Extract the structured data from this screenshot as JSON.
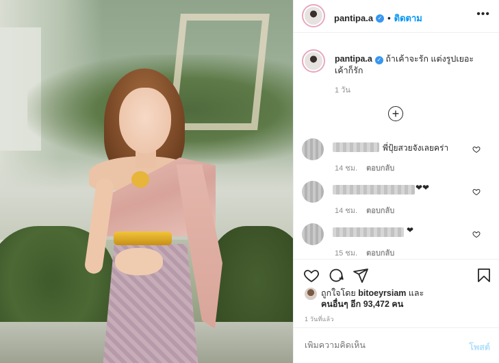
{
  "post": {
    "username": "pantipa.a",
    "follow_label": "ติดตาม",
    "more_icon": "more-horizontal-icon",
    "caption_text": "ถ้าเค้าจะรัก แต่งรูปเยอะเค้าก็รัก",
    "caption_time": "1 วัน",
    "load_more_icon": "plus-circle-icon"
  },
  "comments": [
    {
      "text": "พี่ปุ้ยสวยจังเลยคร่า",
      "time": "14 ชม.",
      "reply": "ตอบกลับ"
    },
    {
      "text": "❤❤",
      "time": "14 ชม.",
      "reply": "ตอบกลับ"
    },
    {
      "text": "❤",
      "time": "15 ชม.",
      "reply": "ตอบกลับ"
    }
  ],
  "actions": {
    "like_icon": "heart-icon",
    "comment_icon": "comment-icon",
    "share_icon": "paper-plane-icon",
    "save_icon": "bookmark-icon"
  },
  "likes": {
    "prefix": "ถูกใจโดย",
    "liker": "bitoeyrsiam",
    "and": "และ",
    "others_label": "คนอื่นๆ อีก 93,472 คน"
  },
  "post_time": "1 วันที่แล้ว",
  "add_comment": {
    "placeholder": "เพิ่มความคิดเห็น",
    "post_label": "โพสต์"
  },
  "colors": {
    "link_blue": "#0095f6",
    "verified_blue": "#3897f0",
    "post_disabled": "#b2dffc",
    "muted_text": "#8e8e8e"
  }
}
